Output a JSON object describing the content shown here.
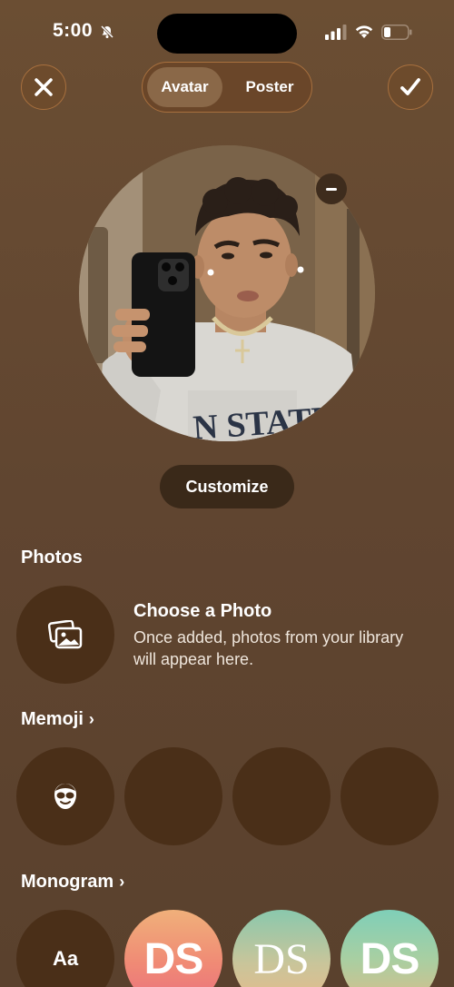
{
  "status": {
    "time": "5:00"
  },
  "tabs": [
    {
      "label": "Avatar",
      "selected": true
    },
    {
      "label": "Poster",
      "selected": false
    }
  ],
  "customize_label": "Customize",
  "photos": {
    "title": "Photos",
    "choose_title": "Choose a Photo",
    "choose_desc": "Once added, photos from your library will appear here."
  },
  "memoji": {
    "title": "Memoji"
  },
  "monogram": {
    "title": "Monogram",
    "aa_label": "Aa",
    "initials": "DS"
  },
  "colors": {
    "background": "#604530",
    "accent_border": "#a8703e",
    "circle": "#4a2f18"
  }
}
